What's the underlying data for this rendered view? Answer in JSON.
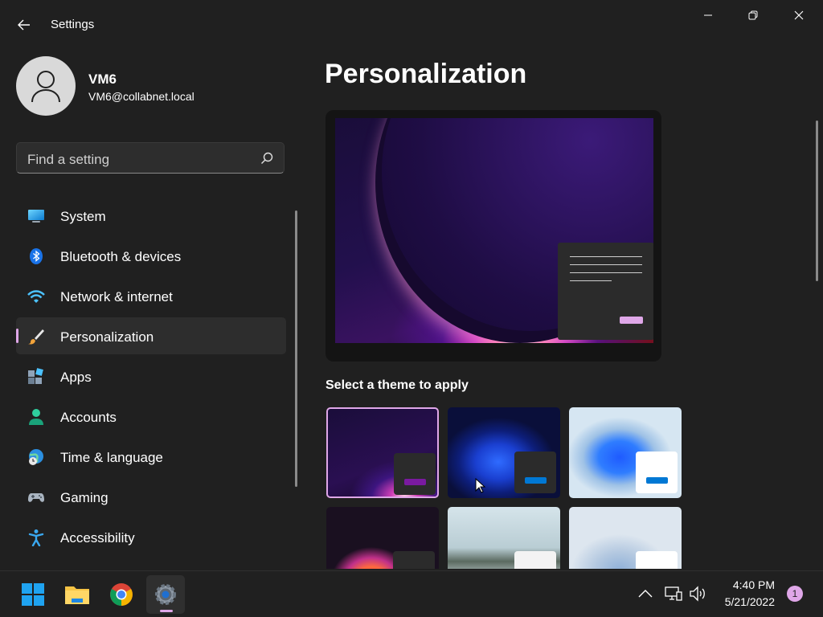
{
  "window": {
    "title": "Settings",
    "controls": {
      "minimize_icon": "minimize-icon",
      "maximize_icon": "restore-icon",
      "close_icon": "close-icon"
    }
  },
  "user": {
    "name": "VM6",
    "email": "VM6@collabnet.local"
  },
  "search": {
    "placeholder": "Find a setting"
  },
  "sidebar": {
    "items": [
      {
        "label": "System",
        "icon": "system-icon",
        "active": false
      },
      {
        "label": "Bluetooth & devices",
        "icon": "bluetooth-icon",
        "active": false
      },
      {
        "label": "Network & internet",
        "icon": "wifi-icon",
        "active": false
      },
      {
        "label": "Personalization",
        "icon": "brush-icon",
        "active": true
      },
      {
        "label": "Apps",
        "icon": "apps-icon",
        "active": false
      },
      {
        "label": "Accounts",
        "icon": "accounts-icon",
        "active": false
      },
      {
        "label": "Time & language",
        "icon": "globe-clock-icon",
        "active": false
      },
      {
        "label": "Gaming",
        "icon": "gamepad-icon",
        "active": false
      },
      {
        "label": "Accessibility",
        "icon": "accessibility-icon",
        "active": false
      }
    ]
  },
  "main": {
    "page_title": "Personalization",
    "themes_heading": "Select a theme to apply",
    "themes": [
      {
        "name": "theme-glow-dark",
        "selected": true
      },
      {
        "name": "theme-bloom-dark",
        "selected": false
      },
      {
        "name": "theme-bloom-light",
        "selected": false
      },
      {
        "name": "theme-flower",
        "selected": false
      },
      {
        "name": "theme-lake",
        "selected": false
      },
      {
        "name": "theme-flow",
        "selected": false
      }
    ]
  },
  "taskbar": {
    "apps": [
      "start-icon",
      "file-explorer-icon",
      "chrome-icon",
      "settings-icon"
    ],
    "tray": [
      "chevron-up-icon",
      "network-icon",
      "volume-icon"
    ],
    "time": "4:40 PM",
    "date": "5/21/2022",
    "notification_count": "1"
  },
  "colors": {
    "accent": "#dfa7e8",
    "background": "#202020",
    "surface": "#2d2d2d"
  }
}
